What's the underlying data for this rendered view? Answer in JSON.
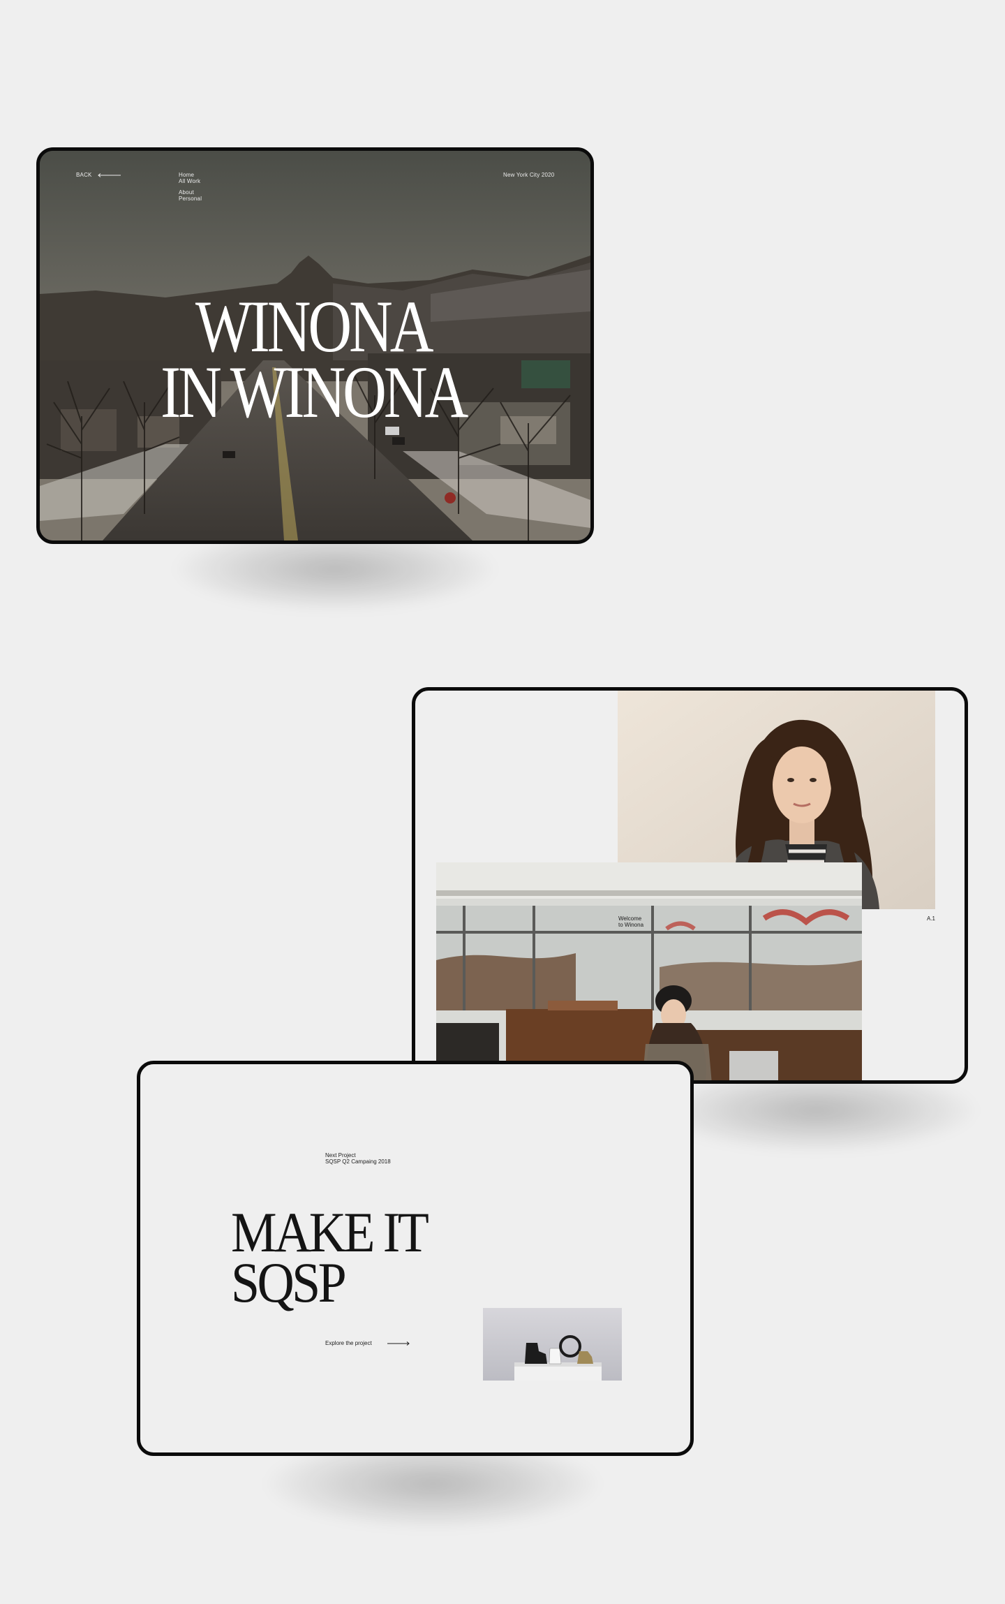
{
  "hero": {
    "back_label": "BACK",
    "nav_items": [
      "Home",
      "All Work",
      "About",
      "Personal"
    ],
    "location": "New York City 2020",
    "title_line1": "WINONA",
    "title_line2": "IN WINONA"
  },
  "portraits": {
    "caption_line1": "Welcome",
    "caption_line2": "to Winona",
    "index_label": "A.1"
  },
  "next_project": {
    "label": "Next Project",
    "project_name": "SQSP Q2 Campaing 2018",
    "title_line1": "MAKE IT",
    "title_line2": "SQSP",
    "cta_label": "Explore the project"
  },
  "colors": {
    "background": "#efefef",
    "device_frame": "#0b0b0b",
    "text_dark": "#141414",
    "text_light": "#ffffff"
  }
}
